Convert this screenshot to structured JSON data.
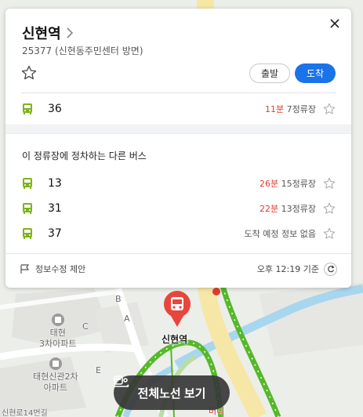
{
  "stop": {
    "name": "신현역",
    "subtitle": "25377 (신현동주민센터 방면)"
  },
  "actions": {
    "depart_label": "출발",
    "arrive_label": "도착"
  },
  "primary_route": {
    "number": "36",
    "minutes": "11분",
    "stops": " 7정류장"
  },
  "other_section": {
    "title": "이 정류장에 정차하는 다른 버스",
    "routes": [
      {
        "number": "13",
        "minutes": "26분",
        "stops": " 15정류장"
      },
      {
        "number": "31",
        "minutes": "22분",
        "stops": " 13정류장"
      },
      {
        "number": "37",
        "minutes": "",
        "stops": "도착 예정 정보 없음"
      }
    ]
  },
  "footer": {
    "report_label": "정보수정 제안",
    "time_label": "오후 12:19 기준"
  },
  "map": {
    "labels": {
      "apt1_line1": "태현",
      "apt1_line2": "3차아파트",
      "apt2_line1": "태현신관2차",
      "apt2_line2": "아파트",
      "road_label": "신현로14번길",
      "bldg_a": "A",
      "bldg_b": "B",
      "bldg_c": "C",
      "bldg_e": "E",
      "partial": "버디"
    },
    "stop_label": "신현역",
    "full_route_label": "전체노선 보기"
  },
  "colors": {
    "accent": "#1a73e8",
    "bus": "#7cb518",
    "minutes": "#e03c31",
    "route_line": "#55b82a"
  }
}
